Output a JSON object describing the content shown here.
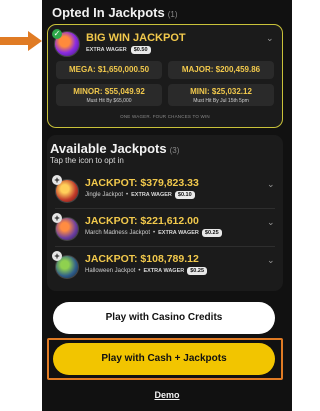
{
  "colors": {
    "accent_gold": "#f2c94c",
    "cash_button": "#f2c500",
    "annotation_orange": "#e07b24",
    "panel_bg": "#111111",
    "opted_border": "#c9c23a"
  },
  "opted": {
    "title": "Opted In Jackpots",
    "count": "(1)",
    "jackpot": {
      "icon": "big-win-jackpot-logo",
      "status_icon": "check-icon",
      "name": "BIG WIN JACKPOT",
      "extra_label": "EXTRA WAGER",
      "wager": "$0.50"
    },
    "tiers": {
      "mega": "MEGA: $1,650,000.50",
      "major": "MAJOR: $200,459.86",
      "minor": "MINOR: $55,049.92",
      "minor_sub": "Must Hit By $65,000",
      "mini": "MINI: $25,032.12",
      "mini_sub": "Must Hit By Jul 15th 5pm"
    },
    "tagline": "ONE WAGER. FOUR CHANCES TO WIN"
  },
  "available": {
    "title": "Available Jackpots",
    "count": "(3)",
    "hint": "Tap the icon to opt in",
    "extra_label": "EXTRA WAGER",
    "items": [
      {
        "amount": "JACKPOT: $379,823.33",
        "name": "Jingle Jackpot",
        "wager": "$0.10",
        "icon": "jingle-jackpot-logo",
        "logo_color": "#c0392b"
      },
      {
        "amount": "JACKPOT: $221,612.00",
        "name": "March Madness Jackpot",
        "wager": "$0.25",
        "icon": "march-madness-logo",
        "logo_color": "#6a3fa0"
      },
      {
        "amount": "JACKPOT: $108,789.12",
        "name": "Halloween Jackpot",
        "wager": "$0.25",
        "icon": "halloween-jackpot-logo",
        "logo_color": "#2f5d8a"
      }
    ]
  },
  "buttons": {
    "casino_credits": "Play with Casino Credits",
    "cash_jackpots": "Play with Cash + Jackpots",
    "demo": "Demo"
  }
}
